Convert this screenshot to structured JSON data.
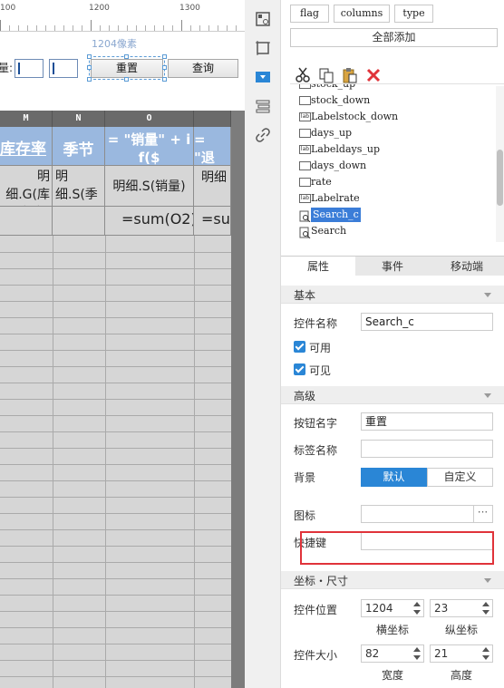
{
  "designer": {
    "ruler": {
      "labels": [
        "100",
        "1200",
        "1300"
      ],
      "position_readout": "1204像素"
    },
    "form": {
      "cut_label": "量:",
      "reset_button": "重置",
      "query_button": "查询"
    },
    "sheet": {
      "columns": [
        "M",
        "N",
        "O"
      ],
      "header_row": [
        "库存率",
        "季节",
        "= \"销量\" + if($",
        "= \"退"
      ],
      "header_tail": "+",
      "sub_row": [
        "明细.G(库存率)",
        "明细.S(季节)",
        "明细.S(销量)",
        "明细"
      ],
      "formula_row": [
        "=sum(O2)",
        "=su"
      ]
    }
  },
  "right_panel": {
    "field_tags": [
      "flag",
      "columns",
      "type"
    ],
    "add_all_button": "全部添加",
    "toolbar": [
      {
        "icon": "scissors-icon",
        "label": "cut"
      },
      {
        "icon": "copy-icon",
        "label": "copy"
      },
      {
        "icon": "paste-icon",
        "label": "paste"
      },
      {
        "icon": "delete-icon",
        "label": "delete"
      }
    ],
    "tree": [
      {
        "label": "stock_up",
        "icon": "box"
      },
      {
        "label": "stock_down",
        "icon": "box"
      },
      {
        "label": "Labelstock_down",
        "icon": "lab"
      },
      {
        "label": "days_up",
        "icon": "box"
      },
      {
        "label": "Labeldays_up",
        "icon": "lab"
      },
      {
        "label": "days_down",
        "icon": "box"
      },
      {
        "label": "rate",
        "icon": "box"
      },
      {
        "label": "Labelrate",
        "icon": "lab"
      },
      {
        "label": "Search_c",
        "icon": "search",
        "selected": true
      },
      {
        "label": "Search",
        "icon": "search"
      }
    ],
    "tabs": [
      "属性",
      "事件",
      "移动端"
    ],
    "sections": {
      "basic": "基本",
      "advanced": "高级",
      "geometry": "坐标・尺寸"
    },
    "properties": {
      "widget_name_label": "控件名称",
      "widget_name_value": "Search_c",
      "enabled_label": "可用",
      "visible_label": "可见",
      "button_text_label": "按钮名字",
      "button_text_value": "重置",
      "tag_name_label": "标签名称",
      "tag_name_value": "",
      "background_label": "背景",
      "bg_default": "默认",
      "bg_custom": "自定义",
      "icon_label": "图标",
      "icon_more": "···",
      "hotkey_label": "快捷键",
      "hotkey_value": "",
      "position_label": "控件位置",
      "x_value": "1204",
      "y_value": "23",
      "x_caption": "横坐标",
      "y_caption": "纵坐标",
      "size_label": "控件大小",
      "width_value": "82",
      "height_value": "21",
      "width_caption": "宽度",
      "height_caption": "高度"
    },
    "colors": {
      "accent": "#2a86d6",
      "highlight_box": "#e0333a",
      "header_cell": "#9ab8df"
    }
  }
}
